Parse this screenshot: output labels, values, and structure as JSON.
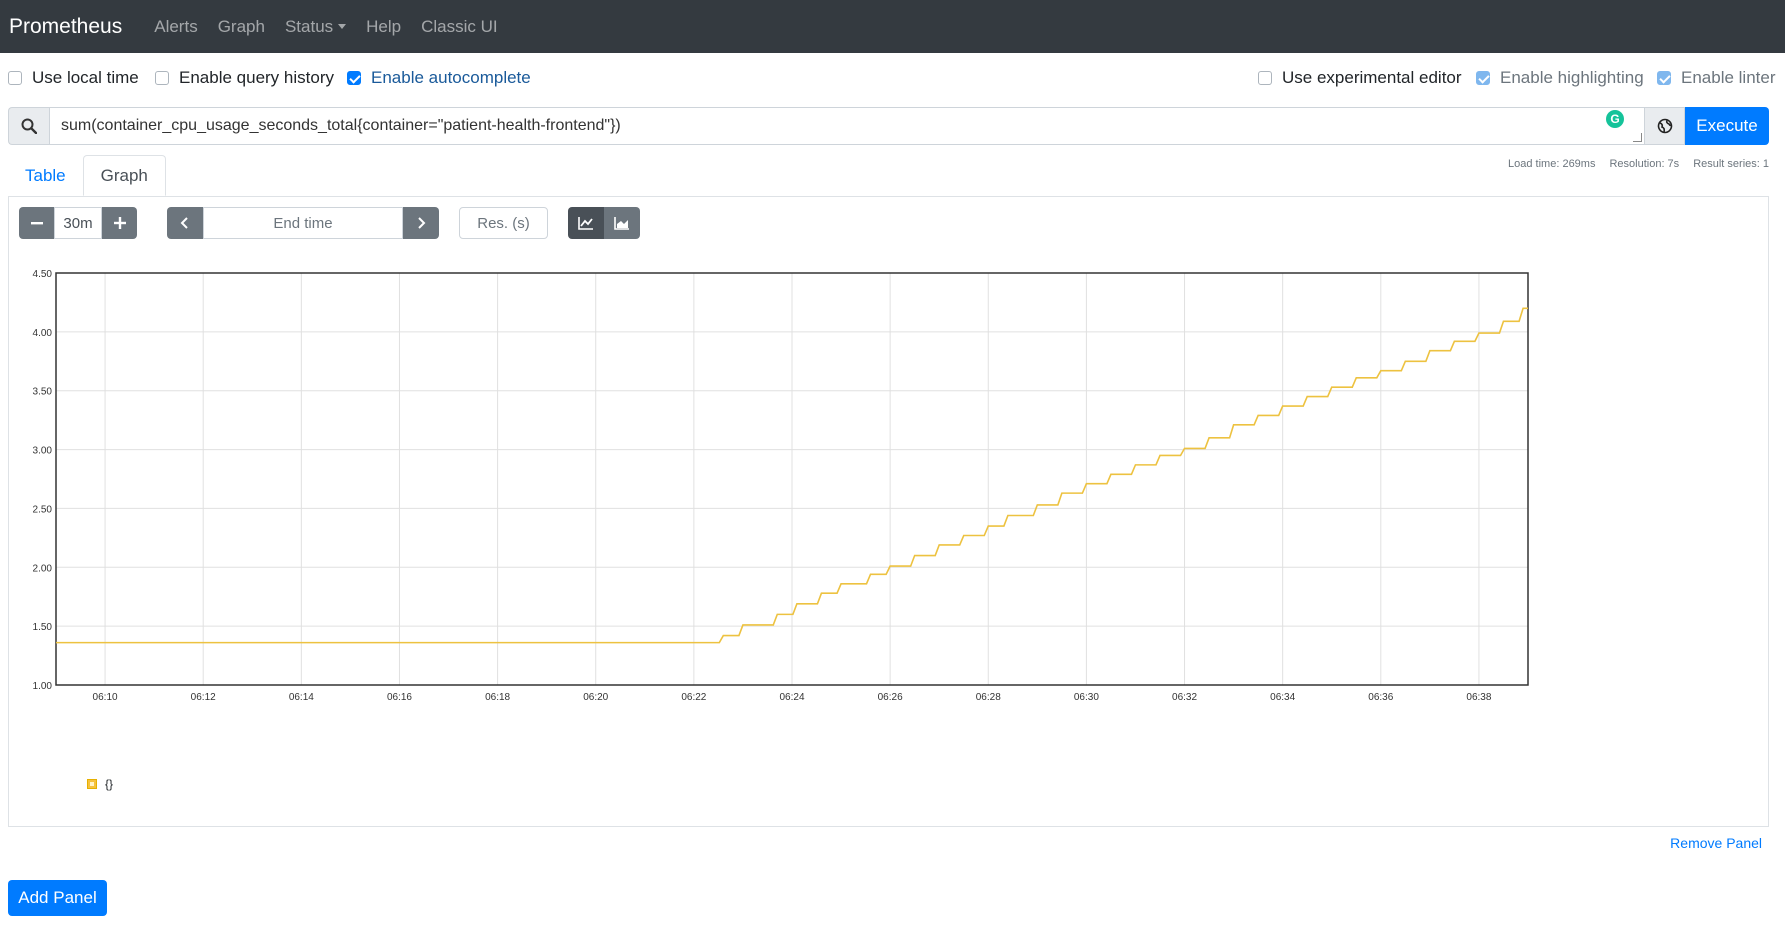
{
  "nav": {
    "brand": "Prometheus",
    "links": [
      "Alerts",
      "Graph",
      "Status",
      "Help",
      "Classic UI"
    ]
  },
  "options": {
    "use_local_time": {
      "label": "Use local time",
      "checked": false
    },
    "query_history": {
      "label": "Enable query history",
      "checked": false
    },
    "autocomplete": {
      "label": "Enable autocomplete",
      "checked": true
    },
    "experimental_editor": {
      "label": "Use experimental editor",
      "checked": false
    },
    "highlighting": {
      "label": "Enable highlighting",
      "checked": true
    },
    "linter": {
      "label": "Enable linter",
      "checked": true
    }
  },
  "query": {
    "expression": "sum(container_cpu_usage_seconds_total{container=\"patient-health-frontend\"})",
    "execute_label": "Execute"
  },
  "tabs": {
    "table": "Table",
    "graph": "Graph"
  },
  "stats": {
    "load_time": "Load time: 269ms",
    "resolution": "Resolution: 7s",
    "result_series": "Result series: 1"
  },
  "controls": {
    "range": "30m",
    "end_time_placeholder": "End time",
    "resolution_placeholder": "Res. (s)"
  },
  "legend": {
    "label": "{}"
  },
  "actions": {
    "remove_panel": "Remove Panel",
    "add_panel": "Add Panel"
  },
  "colors": {
    "series": "#edc240",
    "accent": "#007bff",
    "navbar": "#343a40"
  },
  "chart_data": {
    "type": "line",
    "x_start": "06:09",
    "x_end": "06:39",
    "x_ticks": [
      "06:10",
      "06:12",
      "06:14",
      "06:16",
      "06:18",
      "06:20",
      "06:22",
      "06:24",
      "06:26",
      "06:28",
      "06:30",
      "06:32",
      "06:34",
      "06:36",
      "06:38"
    ],
    "y_ticks": [
      "1.00",
      "1.50",
      "2.00",
      "2.50",
      "3.00",
      "3.50",
      "4.00",
      "4.50"
    ],
    "ylim": [
      1.0,
      4.5
    ],
    "series": [
      {
        "name": "{}",
        "points": [
          [
            "06:09",
            1.36
          ],
          [
            "06:22.3",
            1.36
          ],
          [
            "06:22.6",
            1.42
          ],
          [
            "06:23",
            1.51
          ],
          [
            "06:23.7",
            1.6
          ],
          [
            "06:24.1",
            1.69
          ],
          [
            "06:24.6",
            1.78
          ],
          [
            "06:25",
            1.86
          ],
          [
            "06:25.6",
            1.94
          ],
          [
            "06:26",
            2.01
          ],
          [
            "06:26.5",
            2.1
          ],
          [
            "06:27",
            2.19
          ],
          [
            "06:27.5",
            2.27
          ],
          [
            "06:28",
            2.35
          ],
          [
            "06:28.4",
            2.44
          ],
          [
            "06:29",
            2.53
          ],
          [
            "06:29.5",
            2.63
          ],
          [
            "06:30",
            2.71
          ],
          [
            "06:30.5",
            2.79
          ],
          [
            "06:31",
            2.87
          ],
          [
            "06:31.5",
            2.95
          ],
          [
            "06:32",
            3.01
          ],
          [
            "06:32.5",
            3.1
          ],
          [
            "06:33",
            3.21
          ],
          [
            "06:33.5",
            3.29
          ],
          [
            "06:34",
            3.37
          ],
          [
            "06:34.5",
            3.45
          ],
          [
            "06:35",
            3.53
          ],
          [
            "06:35.5",
            3.61
          ],
          [
            "06:36",
            3.67
          ],
          [
            "06:36.5",
            3.75
          ],
          [
            "06:37",
            3.84
          ],
          [
            "06:37.5",
            3.92
          ],
          [
            "06:38",
            3.99
          ],
          [
            "06:38.5",
            4.09
          ],
          [
            "06:38.9",
            4.2
          ],
          [
            "06:39",
            4.2
          ]
        ]
      }
    ]
  }
}
